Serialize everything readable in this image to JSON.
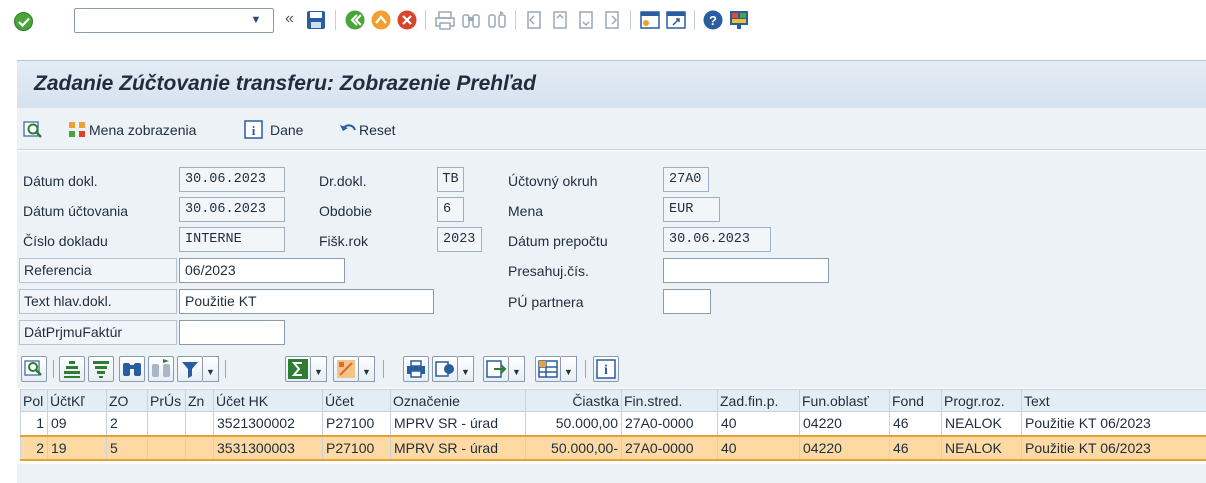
{
  "system_toolbar": {
    "command_field_value": "",
    "icons": [
      "enter-icon",
      "save-icon",
      "back-icon",
      "exit-icon",
      "cancel-icon",
      "print-icon",
      "find-icon",
      "find-next-icon",
      "first-page-icon",
      "previous-page-icon",
      "next-page-icon",
      "last-page-icon",
      "create-session-icon",
      "shortcut-icon",
      "help-icon",
      "customize-layout-icon"
    ]
  },
  "title": "Zadanie Zúčtovanie transferu: Zobrazenie Prehľad",
  "app_toolbar": {
    "currency_label": "Mena zobrazenia",
    "taxes_label": "Dane",
    "reset_label": "Reset"
  },
  "header": {
    "doc_date_label": "Dátum dokl.",
    "doc_date": "30.06.2023",
    "doc_type_label": "Dr.dokl.",
    "doc_type": "TB",
    "company_code_label": "Účtovný okruh",
    "company_code": "27A0",
    "posting_date_label": "Dátum účtovania",
    "posting_date": "30.06.2023",
    "period_label": "Obdobie",
    "period": "6",
    "currency_label": "Mena",
    "currency": "EUR",
    "doc_number_label": "Číslo dokladu",
    "doc_number": "INTERNE",
    "fiscal_year_label": "Fišk.rok",
    "fiscal_year": "2023",
    "translation_date_label": "Dátum prepočtu",
    "translation_date": "30.06.2023",
    "reference_label": "Referencia",
    "reference": "06/2023",
    "cross_cc_label": "Presahuj.čís.",
    "cross_cc": "",
    "header_text_label": "Text hlav.dokl.",
    "header_text": "Použitie KT",
    "trading_partner_label": "PÚ partnera",
    "trading_partner": "",
    "invoice_receipt_label": "DátPrjmuFaktúr",
    "invoice_receipt": ""
  },
  "table": {
    "columns": [
      "Pol",
      "ÚčtKľ",
      "ZO",
      "PrÚs",
      "Zn",
      "Účet HK",
      "Účet",
      "Označenie",
      "Čiastka",
      "Fin.stred.",
      "Zad.fin.p.",
      "Fun.oblasť",
      "Fond",
      "Progr.roz.",
      "Text"
    ],
    "rows": [
      [
        "1",
        "09",
        "2",
        "",
        "",
        "3521300002",
        "P27100",
        "MPRV SR - úrad",
        "50.000,00",
        "27A0-0000",
        "40",
        "04220",
        "46",
        "NEALOK",
        "Použitie KT 06/2023"
      ],
      [
        "2",
        "19",
        "5",
        "",
        "",
        "3531300003",
        "P27100",
        "MPRV SR - úrad",
        "50.000,00-",
        "27A0-0000",
        "40",
        "04220",
        "46",
        "NEALOK",
        "Použitie KT 06/2023"
      ]
    ]
  },
  "colors": {
    "selected_row": "#fdd9a3",
    "panel_bg": "#edf2f7",
    "title_bg": "#dbe5f0"
  }
}
